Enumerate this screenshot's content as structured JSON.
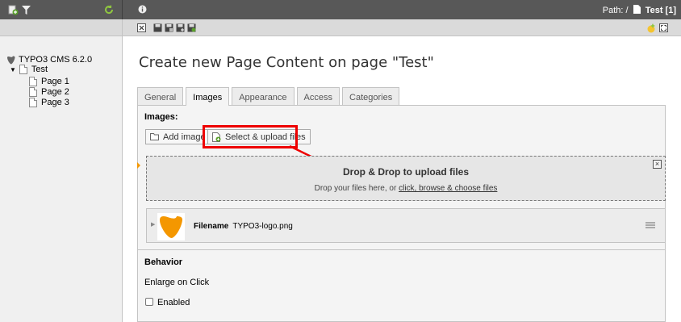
{
  "window": {
    "path_label": "Path: /",
    "path_page": "Test [1]"
  },
  "icons": {
    "new_page": "new-page-icon",
    "filter": "filter-icon",
    "refresh": "refresh-icon",
    "info": "info-icon",
    "close": "close-icon",
    "save": "save-icon",
    "save_view": "save-view-icon",
    "save_new": "save-new-icon",
    "save_close": "save-close-icon",
    "help": "help-icon",
    "fullscreen": "fullscreen-icon"
  },
  "tree": {
    "root_label": "TYPO3 CMS 6.2.0",
    "test_label": "Test",
    "pages": [
      "Page 1",
      "Page 2",
      "Page 3"
    ]
  },
  "main": {
    "title": "Create new Page Content on page \"Test\"",
    "tabs": [
      "General",
      "Images",
      "Appearance",
      "Access",
      "Categories"
    ],
    "active_tab": "Images",
    "images_label": "Images:",
    "add_image_label": "Add image",
    "select_upload_label": "Select & upload files",
    "dropzone": {
      "title": "Drop & Drop to upload files",
      "sub_text": "Drop your files here, or ",
      "link_text": "click, browse & choose files",
      "close": "×"
    },
    "file": {
      "label": "Filename",
      "name": "TYPO3-logo.png"
    },
    "behavior_label": "Behavior",
    "enlarge_label": "Enlarge on Click",
    "enabled_label": "Enabled"
  },
  "colors": {
    "topbar": "#585858",
    "highlight": "#e00000",
    "typo3_orange": "#f49700"
  }
}
